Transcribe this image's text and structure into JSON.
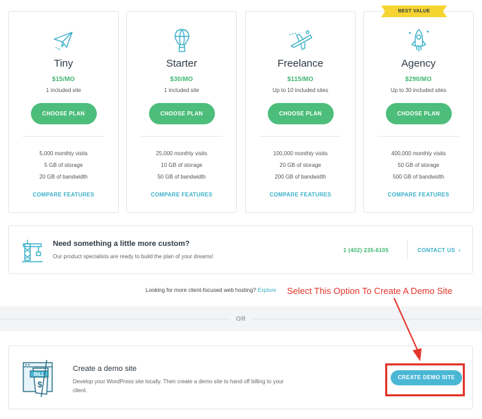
{
  "plans": [
    {
      "name": "Tiny",
      "price": "$15/MO",
      "sites": "1 included site",
      "cta": "CHOOSE PLAN",
      "features": [
        "5,000 monthly visits",
        "5 GB of storage",
        "20 GB of bandwidth"
      ],
      "compare": "COMPARE FEATURES",
      "icon": "paper-plane-icon"
    },
    {
      "name": "Starter",
      "price": "$30/MO",
      "sites": "1 included site",
      "cta": "CHOOSE PLAN",
      "features": [
        "25,000 monthly visits",
        "10 GB of storage",
        "50 GB of bandwidth"
      ],
      "compare": "COMPARE FEATURES",
      "icon": "hot-air-balloon-icon"
    },
    {
      "name": "Freelance",
      "price": "$115/MO",
      "sites": "Up to 10 included sites",
      "cta": "CHOOSE PLAN",
      "features": [
        "100,000 monthly visits",
        "20 GB of storage",
        "200 GB of bandwidth"
      ],
      "compare": "COMPARE FEATURES",
      "icon": "airplane-icon"
    },
    {
      "name": "Agency",
      "price": "$290/MO",
      "sites": "Up to 30 included sites",
      "cta": "CHOOSE PLAN",
      "features": [
        "400,000 monthly visits",
        "50 GB of storage",
        "500 GB of bandwidth"
      ],
      "compare": "COMPARE FEATURES",
      "icon": "rocket-icon"
    }
  ],
  "badge": "BEST VALUE",
  "custom": {
    "title": "Need something a little more custom?",
    "subtitle": "Our product specialists are ready to build the plan of your dreams!",
    "phone": "1 (402) 235-6105",
    "contact": "CONTACT US",
    "contact_arrow": "›"
  },
  "looking": {
    "text": "Looking for more client-focused web hosting?",
    "link": "Explore"
  },
  "or": "OR",
  "demo": {
    "title": "Create a demo site",
    "description": "Develop your WordPress site locally. Then create a demo site to hand off billing to your client.",
    "button": "CREATE DEMO SITE",
    "bill_label": "BILL",
    "dollar": "$"
  },
  "annotation": {
    "text": "Select This Option To Create A Demo Site",
    "color": "#e3352a"
  },
  "colors": {
    "green": "#4cbd7a",
    "teal": "#3bb0c9",
    "badge": "#f5d431",
    "demo_button": "#4ab7d4"
  }
}
